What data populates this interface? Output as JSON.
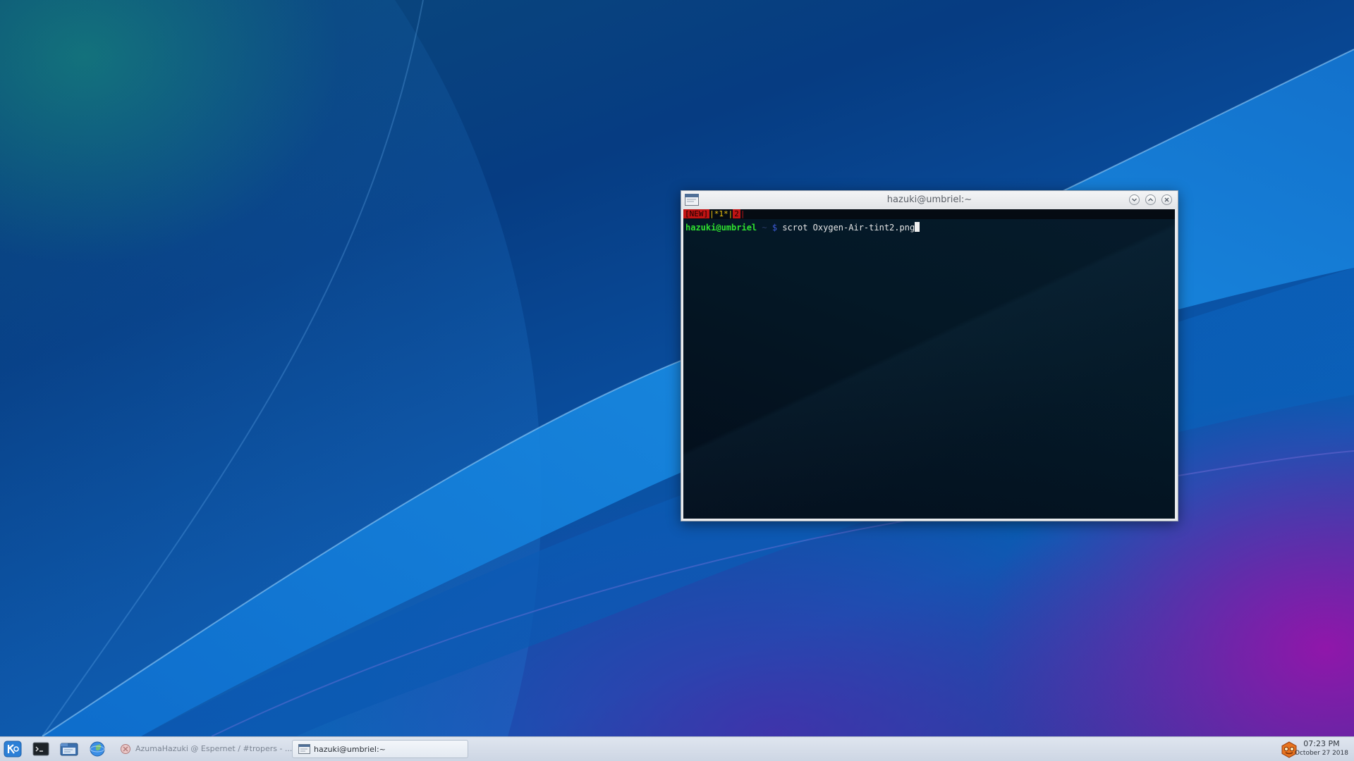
{
  "window": {
    "title": "hazuki@umbriel:~",
    "buttons": [
      "minimize",
      "maximize",
      "close"
    ]
  },
  "terminal": {
    "status_tags": [
      "[NEW]",
      "|*1*|",
      "2",
      "|"
    ],
    "prompt_user": "hazuki@umbriel",
    "prompt_dir": "~",
    "prompt_symbol": "$",
    "command": "scrot Oxygen-Air-tint2.png"
  },
  "taskbar": {
    "launchers": [
      {
        "icon": "kde-menu-icon"
      },
      {
        "icon": "terminal-icon"
      },
      {
        "icon": "file-manager-icon"
      },
      {
        "icon": "web-browser-icon"
      }
    ],
    "tasks": [
      {
        "label": "AzumaHazuki @ Espernet / #tropers - ...",
        "icon": "irc-client-icon",
        "active": false
      },
      {
        "label": "hazuki@umbriel:~",
        "icon": "terminal-window-icon",
        "active": true
      }
    ],
    "tray_icon": "hexchat-tray-icon",
    "clock": {
      "time": "07:23 PM",
      "date": "October 27 2018"
    }
  },
  "colors": {
    "prompt_user": "#2fe02f",
    "tag_new_bg": "#c01414",
    "tag_active": "#f1c40f"
  }
}
